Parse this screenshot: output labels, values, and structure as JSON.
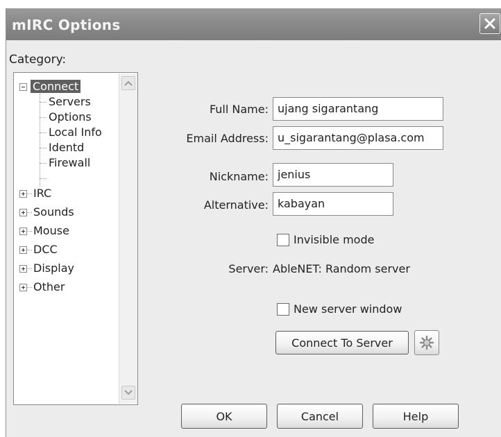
{
  "window": {
    "title": "mIRC Options",
    "close_icon": "close-icon"
  },
  "category": {
    "label": "Category:",
    "tree": [
      {
        "label": "Connect",
        "expander": "minus",
        "selected": true
      },
      {
        "label": "Servers"
      },
      {
        "label": "Options"
      },
      {
        "label": "Local Info"
      },
      {
        "label": "Identd"
      },
      {
        "label": "Firewall"
      },
      {
        "label": "IRC",
        "expander": "plus"
      },
      {
        "label": "Sounds",
        "expander": "plus"
      },
      {
        "label": "Mouse",
        "expander": "plus"
      },
      {
        "label": "DCC",
        "expander": "plus"
      },
      {
        "label": "Display",
        "expander": "plus"
      },
      {
        "label": "Other",
        "expander": "plus"
      }
    ]
  },
  "form": {
    "full_name_label": "Full Name:",
    "full_name_value": "ujang sigarantang",
    "email_label": "Email Address:",
    "email_value": "u_sigarantang@plasa.com",
    "nickname_label": "Nickname:",
    "nickname_value": "jenius",
    "alternative_label": "Alternative:",
    "alternative_value": "kabayan",
    "invisible_label": "Invisible mode",
    "invisible_checked": false,
    "server_label": "Server:",
    "server_value": "AbleNET: Random server",
    "new_window_label": "New server window",
    "new_window_checked": false,
    "connect_button": "Connect To Server",
    "connect_icon": "gear-icon"
  },
  "footer": {
    "ok": "OK",
    "cancel": "Cancel",
    "help": "Help"
  }
}
